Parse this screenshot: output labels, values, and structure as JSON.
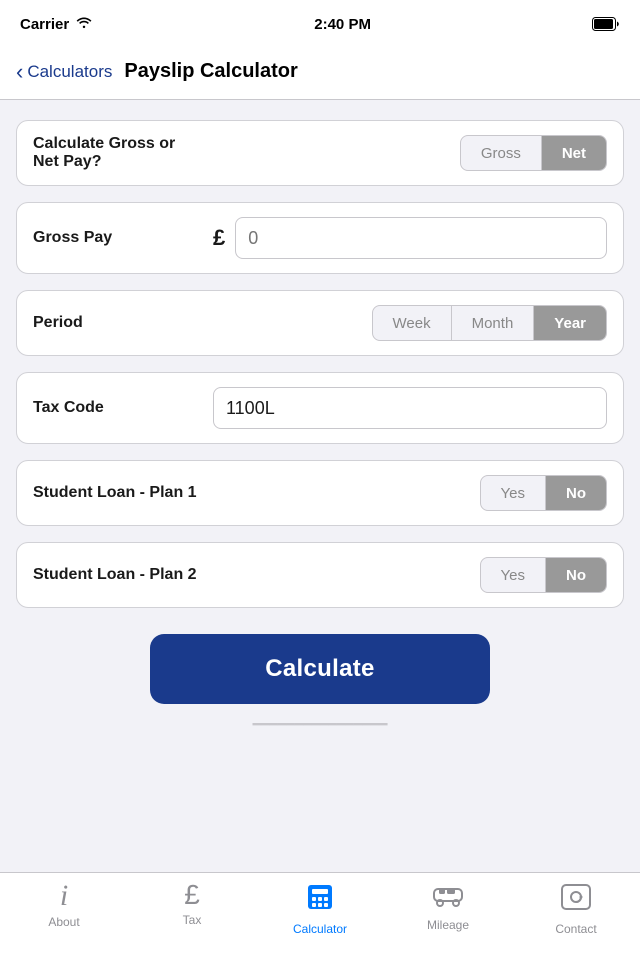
{
  "status": {
    "carrier": "Carrier",
    "time": "2:40 PM"
  },
  "nav": {
    "back_label": "Calculators",
    "title": "Payslip Calculator"
  },
  "form": {
    "gross_net_label": "Calculate Gross or\nNet Pay?",
    "gross_net_options": [
      "Gross",
      "Net"
    ],
    "gross_net_selected": "Net",
    "gross_pay_label": "Gross Pay",
    "gross_pay_currency": "£",
    "gross_pay_placeholder": "0",
    "period_label": "Period",
    "period_options": [
      "Week",
      "Month",
      "Year"
    ],
    "period_selected": "Year",
    "tax_code_label": "Tax Code",
    "tax_code_value": "1100L",
    "student_loan_1_label": "Student Loan - Plan 1",
    "student_loan_1_options": [
      "Yes",
      "No"
    ],
    "student_loan_1_selected": "No",
    "student_loan_2_label": "Student Loan - Plan 2",
    "student_loan_2_options": [
      "Yes",
      "No"
    ],
    "student_loan_2_selected": "No",
    "calculate_btn": "Calculate"
  },
  "tabs": [
    {
      "id": "about",
      "label": "About",
      "icon": "info"
    },
    {
      "id": "tax",
      "label": "Tax",
      "icon": "pound"
    },
    {
      "id": "calculator",
      "label": "Calculator",
      "icon": "calc",
      "active": true
    },
    {
      "id": "mileage",
      "label": "Mileage",
      "icon": "car"
    },
    {
      "id": "contact",
      "label": "Contact",
      "icon": "at"
    }
  ]
}
